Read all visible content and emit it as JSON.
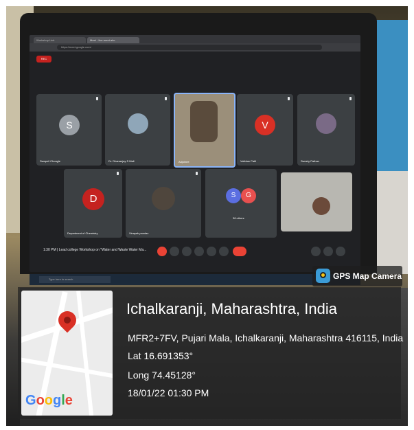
{
  "browser": {
    "tabs": [
      "Workshop Link",
      "Meet - live-meet-abc"
    ],
    "address": "https://meet.google.com/"
  },
  "meet": {
    "rec_label": "REC",
    "participants": [
      {
        "name": "Swapnil Chougle",
        "initial": "S",
        "color": "#9aa0a6"
      },
      {
        "name": "Dr. Dhananjay S Mali",
        "initial": ""
      },
      {
        "name": "Adjoinee",
        "initial": ""
      },
      {
        "name": "Vaibhav Patil",
        "initial": "V",
        "color": "#d93025"
      },
      {
        "name": "Sweety Pathan",
        "initial": ""
      },
      {
        "name": "Department of Chemistry",
        "initial": "D",
        "color": "#c5221f"
      },
      {
        "name": "Vinayak pandav",
        "initial": ""
      },
      {
        "name": "38 others",
        "initials": [
          "S",
          "G"
        ],
        "colors": [
          "#5b6ee1",
          "#e8504f"
        ]
      },
      {
        "name": "",
        "initial": ""
      }
    ],
    "time": "1:30 PM",
    "meeting_title": "Lead college Workshop on \"Water and Waste Water Ma...",
    "taskbar_search": "Type here to search"
  },
  "overlay": {
    "app_name": "GPS Map Camera",
    "place": "Ichalkaranji, Maharashtra, India",
    "address": "MFR2+7FV, Pujari Mala, Ichalkaranji, Maharashtra 416115, India",
    "lat": "Lat 16.691353°",
    "long": "Long 74.45128°",
    "datetime": "18/01/22 01:30 PM",
    "map_brand": "Google"
  },
  "colors": {
    "meet_bg": "#202124",
    "tile_bg": "#3c4043",
    "end_call": "#ea4335",
    "pin": "#d93025"
  }
}
